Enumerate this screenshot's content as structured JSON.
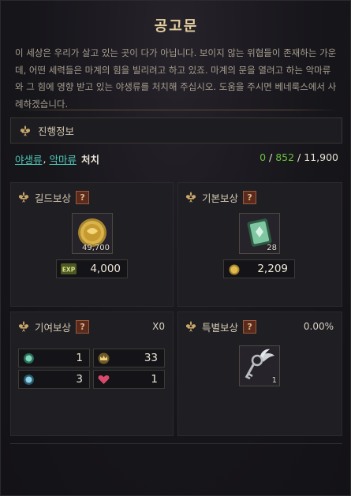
{
  "title": "공고문",
  "description": "이 세상은 우리가 살고 있는 곳이 다가 아닙니다. 보이지 않는 위협들이 존재하는 가운데, 어떤 세력들은 마계의 힘을 빌리려고 하고 있죠. 마계의 문을 열려고 하는 악마류와 그 힘에 영향 받고 있는 야생류를 처치해 주십시오. 도움을 주시면 베네룩스에서 사례하겠습니다.",
  "progress": {
    "header": "진행정보",
    "objective": {
      "target1": "야생류",
      "separator": ",",
      "target2": "악마류",
      "verb": "처치"
    },
    "count": {
      "current": "0",
      "slash1": "/",
      "required": "852",
      "slash2": "/",
      "total": "11,900"
    }
  },
  "guild_reward": {
    "label": "길드보상",
    "help": "?",
    "item_qty": "49,700",
    "exp_value": "4,000",
    "exp_icon_text": "EXP"
  },
  "basic_reward": {
    "label": "기본보상",
    "help": "?",
    "item_qty": "28",
    "coin_value": "2,209"
  },
  "contribution_reward": {
    "label": "기여보상",
    "help": "?",
    "multiplier": "X0",
    "cells": [
      "1",
      "33",
      "3",
      "1"
    ]
  },
  "special_reward": {
    "label": "특별보상",
    "help": "?",
    "chance": "0.00%",
    "item_qty": "1"
  },
  "colors": {
    "accent_gold": "#e4cfa0",
    "link_teal": "#4fc9b7",
    "count_green": "#6bbf3d"
  },
  "icons": {
    "section": "fleur-de-lis-icon",
    "guild_item": "gold-medal-icon",
    "basic_item": "green-gem-card-icon",
    "exp": "exp-icon",
    "coin": "gold-coin-icon",
    "special_item": "winged-key-icon"
  }
}
